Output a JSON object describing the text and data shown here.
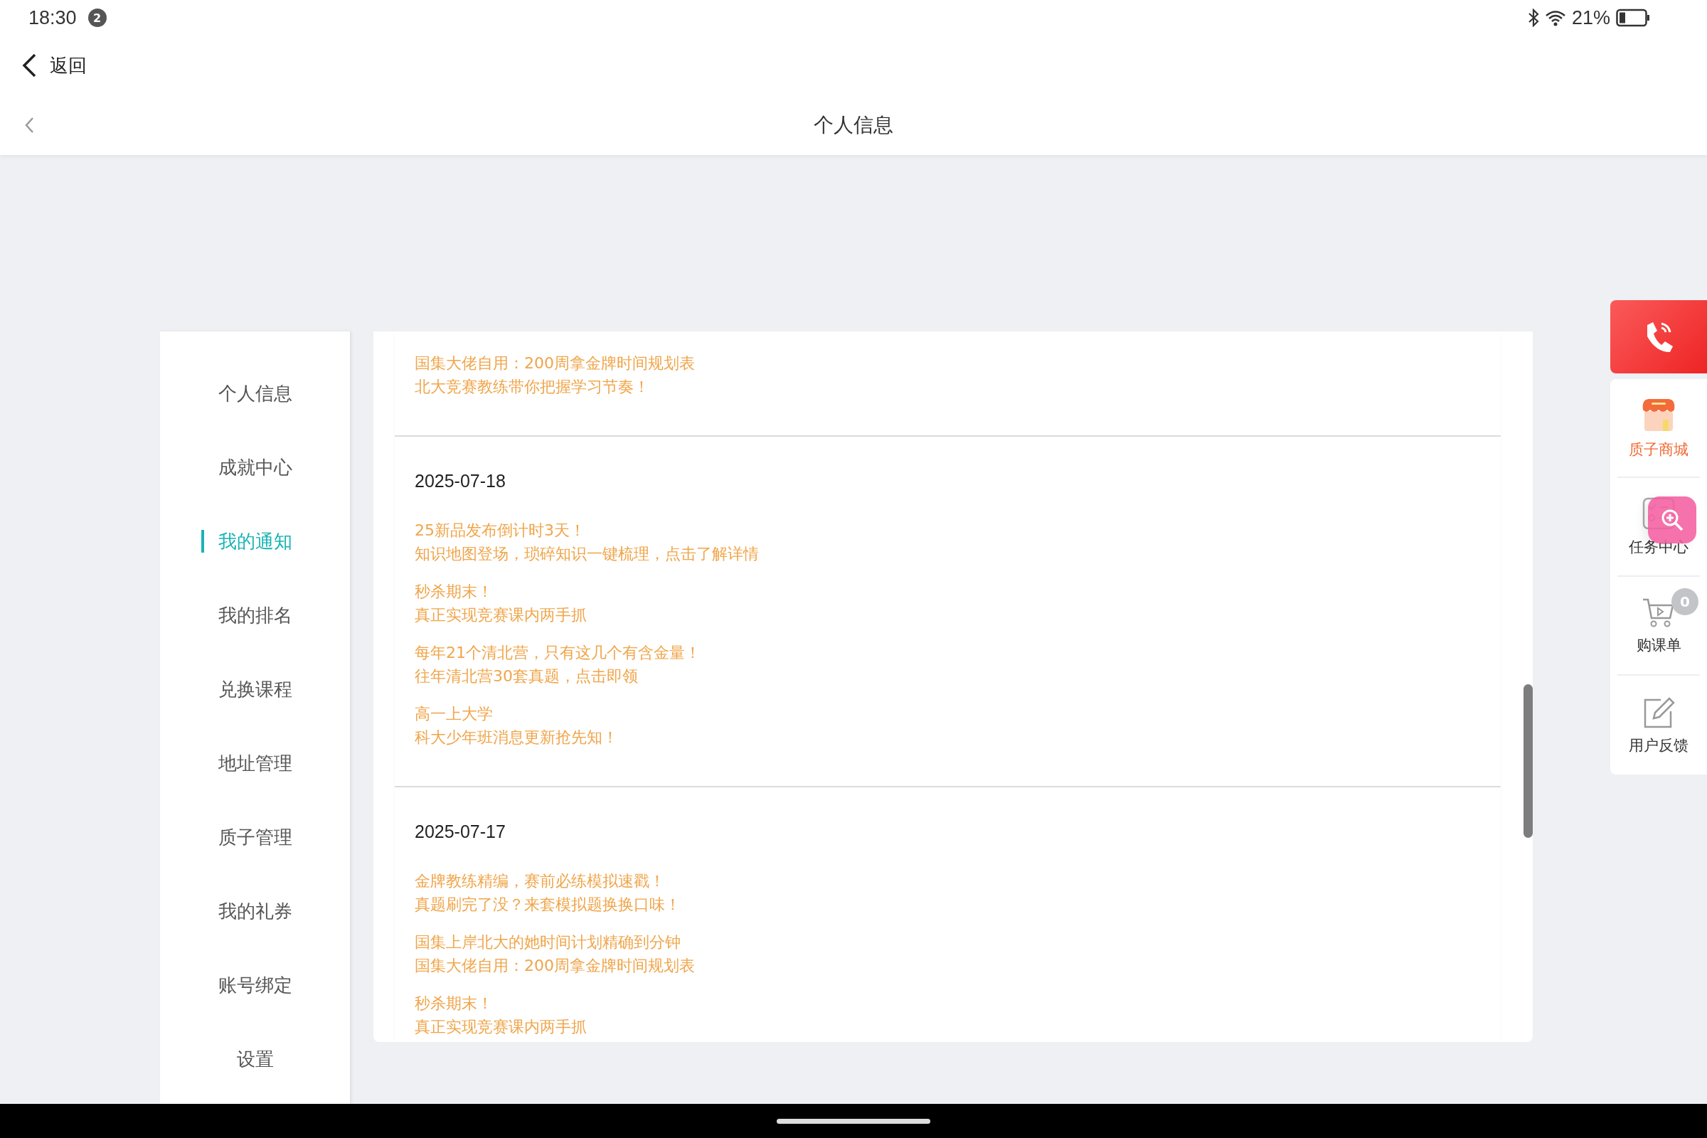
{
  "status_bar": {
    "time": "18:30",
    "notification_count": "2",
    "battery": "21%"
  },
  "header": {
    "back_label": "返回",
    "title": "个人信息"
  },
  "sidebar": {
    "items": [
      {
        "label": "个人信息",
        "selected": false
      },
      {
        "label": "成就中心",
        "selected": false
      },
      {
        "label": "我的通知",
        "selected": true
      },
      {
        "label": "我的排名",
        "selected": false
      },
      {
        "label": "兑换课程",
        "selected": false
      },
      {
        "label": "地址管理",
        "selected": false
      },
      {
        "label": "质子管理",
        "selected": false
      },
      {
        "label": "我的礼券",
        "selected": false
      },
      {
        "label": "账号绑定",
        "selected": false
      },
      {
        "label": "设置",
        "selected": false
      }
    ]
  },
  "notifications": [
    {
      "messages": [
        {
          "title": "国集大佬自用：200周拿金牌时间规划表",
          "subtitle": "北大竞赛教练带你把握学习节奏！"
        }
      ]
    },
    {
      "date": "2025-07-18",
      "messages": [
        {
          "title": "25新品发布倒计时3天！",
          "subtitle": "知识地图登场，琐碎知识一键梳理，点击了解详情"
        },
        {
          "title": "秒杀期末！",
          "subtitle": "真正实现竞赛课内两手抓"
        },
        {
          "title": "每年21个清北营，只有这几个有含金量！",
          "subtitle": "往年清北营30套真题，点击即领"
        },
        {
          "title": "高一上大学",
          "subtitle": "科大少年班消息更新抢先知！"
        }
      ]
    },
    {
      "date": "2025-07-17",
      "messages": [
        {
          "title": "金牌教练精编，赛前必练模拟速戳！",
          "subtitle": "真题刷完了没？来套模拟题换换口味！"
        },
        {
          "title": "国集上岸北大的她时间计划精确到分钟",
          "subtitle": "国集大佬自用：200周拿金牌时间规划表"
        },
        {
          "title": "秒杀期末！",
          "subtitle": "真正实现竞赛课内两手抓"
        }
      ]
    }
  ],
  "side_panel": {
    "items": [
      {
        "kind": "store",
        "label": "质子商城"
      },
      {
        "kind": "tasks",
        "label": "任务中心"
      },
      {
        "kind": "cart",
        "label": "购课单",
        "badge": "0"
      },
      {
        "kind": "feedback",
        "label": "用户反馈"
      }
    ]
  }
}
